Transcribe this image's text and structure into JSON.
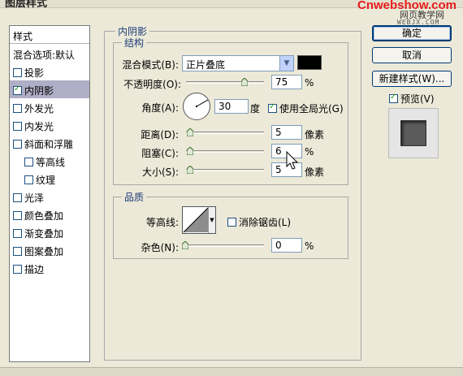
{
  "window": {
    "title": "图层样式"
  },
  "watermark": {
    "brand": "Cnwebshow.com",
    "cn": "网页教学网",
    "url": "WEBJX.COM"
  },
  "style_list": {
    "header": "样式",
    "blend_options": "混合选项:默认",
    "items": [
      {
        "label": "投影",
        "checked": false
      },
      {
        "label": "内阴影",
        "checked": true,
        "selected": true
      },
      {
        "label": "外发光",
        "checked": false
      },
      {
        "label": "内发光",
        "checked": false
      },
      {
        "label": "斜面和浮雕",
        "checked": false
      },
      {
        "label": "等高线",
        "checked": false
      },
      {
        "label": "纹理",
        "checked": false
      },
      {
        "label": "光泽",
        "checked": false
      },
      {
        "label": "颜色叠加",
        "checked": false
      },
      {
        "label": "渐变叠加",
        "checked": false
      },
      {
        "label": "图案叠加",
        "checked": false
      },
      {
        "label": "描边",
        "checked": false
      }
    ]
  },
  "panel": {
    "title": "内阴影",
    "structure": {
      "legend": "结构",
      "blend_mode_label": "混合模式(B):",
      "blend_mode_value": "正片叠底",
      "shadow_color": "#000000",
      "opacity_label": "不透明度(O):",
      "opacity_value": "75",
      "opacity_unit": "%",
      "opacity_level": 0.75,
      "angle_label": "角度(A):",
      "angle_value": "30",
      "angle_unit": "度",
      "global_light_label": "使用全局光(G)",
      "global_light_checked": true,
      "distance_label": "距离(D):",
      "distance_value": "5",
      "distance_unit": "像素",
      "choke_label": "阻塞(C):",
      "choke_value": "6",
      "choke_unit": "%",
      "size_label": "大小(S):",
      "size_value": "5",
      "size_unit": "像素"
    },
    "quality": {
      "legend": "品质",
      "contour_label": "等高线:",
      "antialias_label": "消除锯齿(L)",
      "antialias_checked": false,
      "noise_label": "杂色(N):",
      "noise_value": "0",
      "noise_unit": "%"
    }
  },
  "buttons": {
    "ok": "确定",
    "cancel": "取消",
    "new_style": "新建样式(W)...",
    "preview_label": "预览(V)",
    "preview_checked": true
  }
}
